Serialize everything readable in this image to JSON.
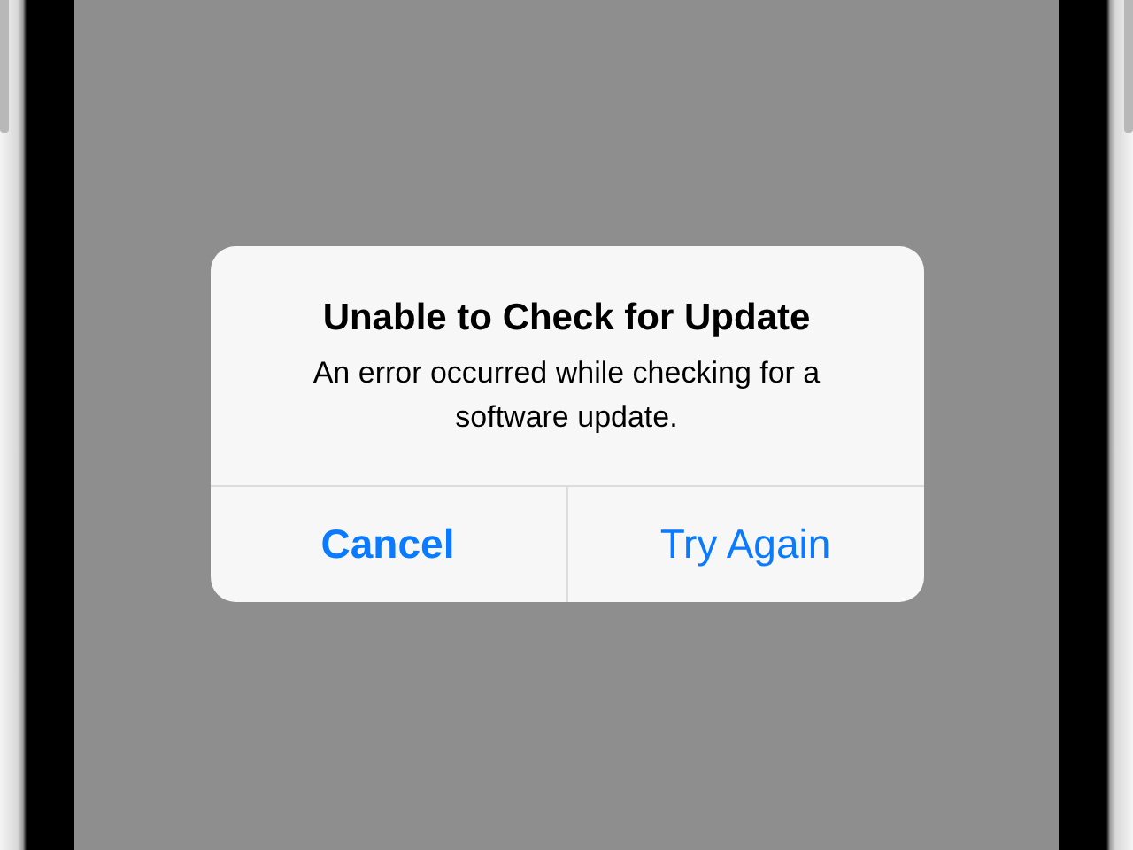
{
  "alert": {
    "title": "Unable to Check for Update",
    "message": "An error occurred while checking for a software update.",
    "buttons": [
      {
        "label": "Cancel",
        "kind": "cancel"
      },
      {
        "label": "Try Again",
        "kind": "default"
      }
    ]
  }
}
